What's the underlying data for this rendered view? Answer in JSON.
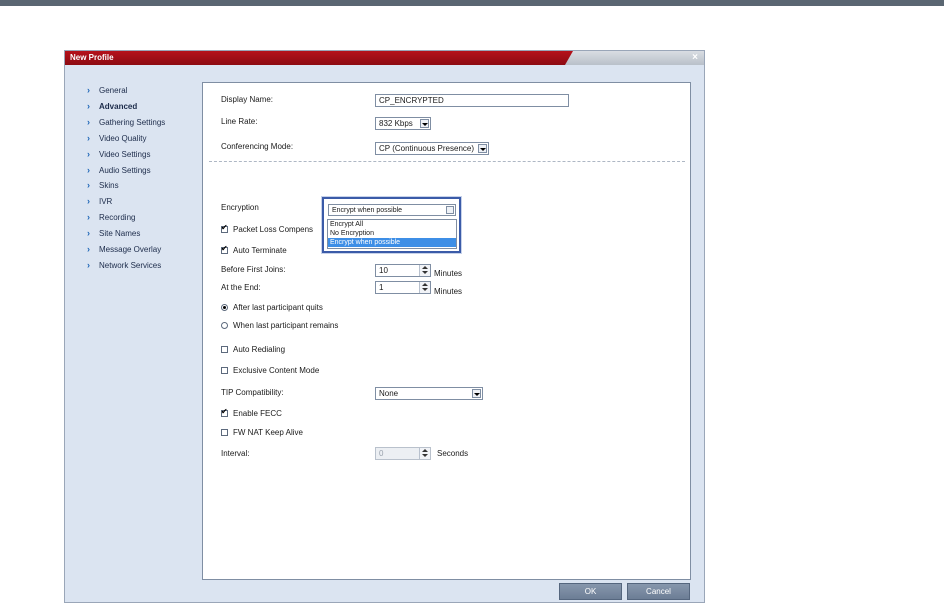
{
  "window": {
    "title": "New Profile",
    "close_symbol": "×"
  },
  "sidebar": {
    "items": [
      {
        "label": "General"
      },
      {
        "label": "Advanced",
        "active": true
      },
      {
        "label": "Gathering Settings"
      },
      {
        "label": "Video Quality"
      },
      {
        "label": "Video Settings"
      },
      {
        "label": "Audio Settings"
      },
      {
        "label": "Skins"
      },
      {
        "label": "IVR"
      },
      {
        "label": "Recording"
      },
      {
        "label": "Site Names"
      },
      {
        "label": "Message Overlay"
      },
      {
        "label": "Network Services"
      }
    ]
  },
  "form": {
    "display_name": {
      "label": "Display Name:",
      "value": "CP_ENCRYPTED"
    },
    "line_rate": {
      "label": "Line Rate:",
      "value": "832 Kbps"
    },
    "conferencing_mode": {
      "label": "Conferencing Mode:",
      "value": "CP (Continuous Presence)"
    },
    "encryption": {
      "label": "Encryption",
      "value": "Encrypt when possible",
      "options": [
        "Encrypt All",
        "No Encryption",
        "Encrypt when possible"
      ],
      "highlighted": "Encrypt when possible"
    },
    "packet_loss": {
      "label": "Packet Loss Compens",
      "checked": true
    },
    "auto_terminate": {
      "label": "Auto Terminate",
      "checked": true
    },
    "before_first_joins": {
      "label": "Before First Joins:",
      "value": "10",
      "unit": "Minutes"
    },
    "at_the_end": {
      "label": "At the End:",
      "value": "1",
      "unit": "Minutes"
    },
    "after_last_quits": {
      "label": "After last participant quits",
      "selected": true
    },
    "when_last_remains": {
      "label": "When last participant remains",
      "selected": false
    },
    "auto_redialing": {
      "label": "Auto Redialing",
      "checked": false
    },
    "exclusive_content": {
      "label": "Exclusive Content Mode",
      "checked": false
    },
    "tip_compat": {
      "label": "TIP Compatibility:",
      "value": "None"
    },
    "enable_fecc": {
      "label": "Enable FECC",
      "checked": true
    },
    "fw_nat": {
      "label": "FW NAT Keep Alive",
      "checked": false
    },
    "interval": {
      "label": "Interval:",
      "value": "0",
      "unit": "Seconds"
    }
  },
  "buttons": {
    "ok": "OK",
    "cancel": "Cancel"
  }
}
